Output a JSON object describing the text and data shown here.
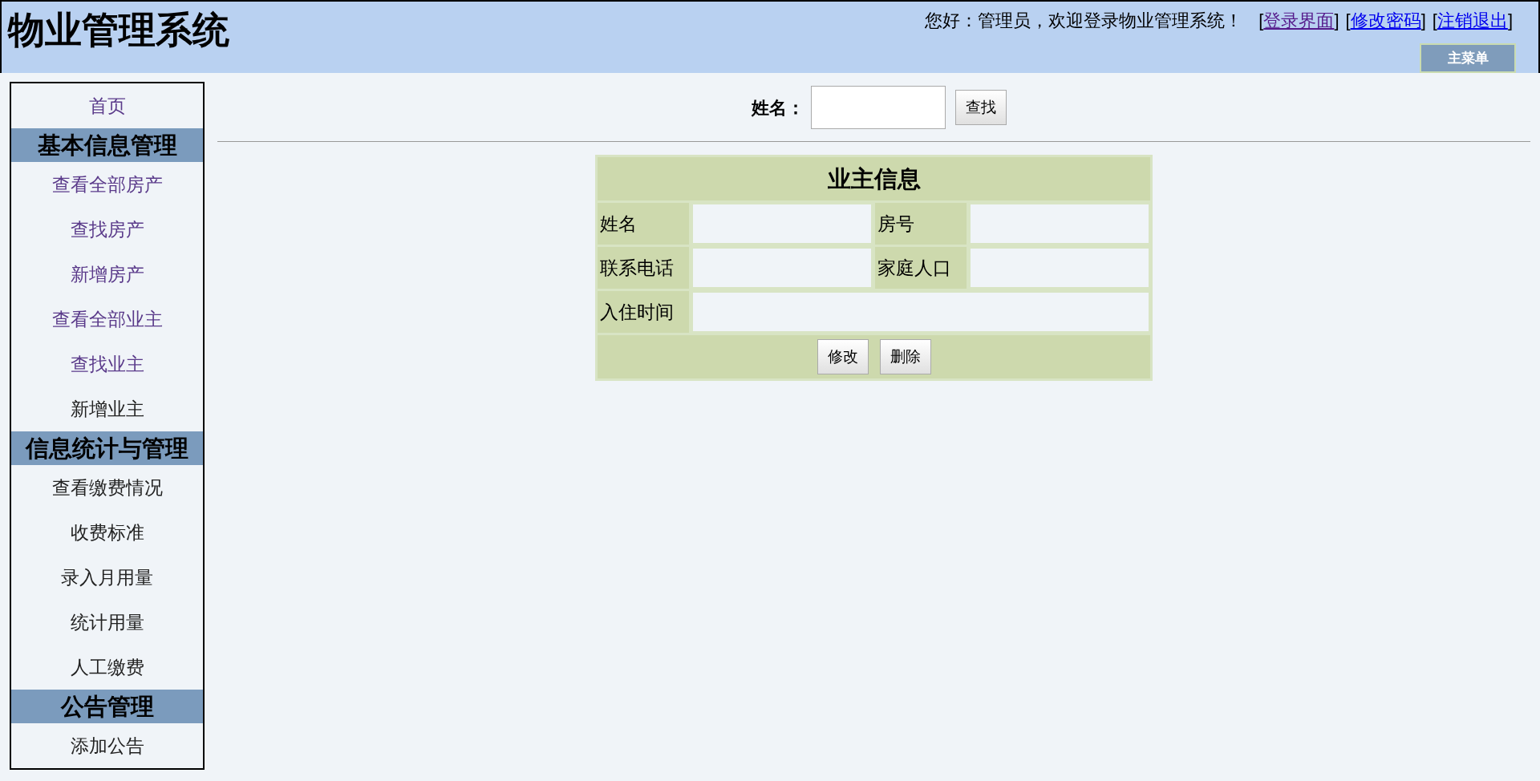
{
  "header": {
    "title": "物业管理系统",
    "greeting": "您好：管理员，欢迎登录物业管理系统！",
    "links": [
      {
        "open": "[",
        "label": "登录界面",
        "close": "]",
        "visited": true
      },
      {
        "open": "[",
        "label": "修改密码",
        "close": "]",
        "visited": false
      },
      {
        "open": "[",
        "label": "注销退出",
        "close": "]",
        "visited": false
      }
    ],
    "menu_button": "主菜单"
  },
  "sidebar": {
    "items": [
      {
        "kind": "link",
        "label": "首页",
        "visited": true
      },
      {
        "kind": "section",
        "label": "基本信息管理"
      },
      {
        "kind": "link",
        "label": "查看全部房产",
        "visited": true
      },
      {
        "kind": "link",
        "label": "查找房产",
        "visited": true
      },
      {
        "kind": "link",
        "label": "新增房产",
        "visited": true
      },
      {
        "kind": "link",
        "label": "查看全部业主",
        "visited": true
      },
      {
        "kind": "link",
        "label": "查找业主",
        "visited": true
      },
      {
        "kind": "link",
        "label": "新增业主",
        "visited": false
      },
      {
        "kind": "section",
        "label": "信息统计与管理"
      },
      {
        "kind": "link",
        "label": "查看缴费情况",
        "visited": false
      },
      {
        "kind": "link",
        "label": "收费标准",
        "visited": false
      },
      {
        "kind": "link",
        "label": "录入月用量",
        "visited": false
      },
      {
        "kind": "link",
        "label": "统计用量",
        "visited": false
      },
      {
        "kind": "link",
        "label": "人工缴费",
        "visited": false
      },
      {
        "kind": "section",
        "label": "公告管理"
      },
      {
        "kind": "link",
        "label": "添加公告",
        "visited": false
      }
    ]
  },
  "search": {
    "label": "姓名：",
    "button": "查找"
  },
  "owner_form": {
    "title": "业主信息",
    "fields": [
      {
        "label": "姓名"
      },
      {
        "label": "房号"
      },
      {
        "label": "联系电话"
      },
      {
        "label": "家庭人口"
      },
      {
        "label": "入住时间"
      }
    ],
    "buttons": [
      "修改",
      "删除"
    ]
  }
}
